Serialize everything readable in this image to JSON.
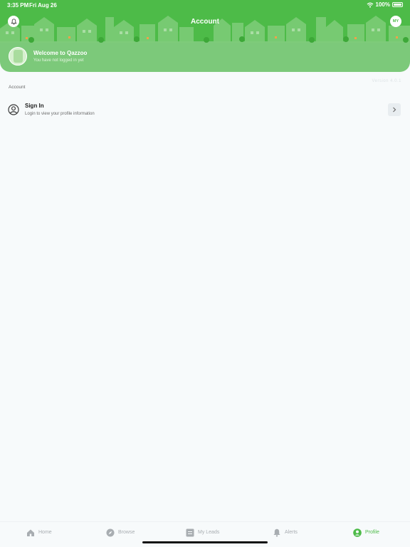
{
  "status_bar": {
    "time": "3:35 PM",
    "date": "Fri Aug 26",
    "battery": "100%"
  },
  "header": {
    "title": "Account",
    "language_badge": "MY"
  },
  "welcome": {
    "title": "Welcome to Qazzoo",
    "subtitle": "You have not logged in yet"
  },
  "version": "Version 4.0.1",
  "section": {
    "label": "Account"
  },
  "signin": {
    "title": "Sign In",
    "subtitle": "Login to view your profile information"
  },
  "tabs": [
    {
      "label": "Home",
      "icon": "home-icon",
      "active": false
    },
    {
      "label": "Browse",
      "icon": "compass-icon",
      "active": false
    },
    {
      "label": "My Leads",
      "icon": "list-icon",
      "active": false
    },
    {
      "label": "Alerts",
      "icon": "bell-icon",
      "active": false
    },
    {
      "label": "Profile",
      "icon": "person-icon",
      "active": true
    }
  ],
  "colors": {
    "brand_green": "#4dbb48",
    "header_light": "#7cc97a",
    "background": "#f7fafb",
    "inactive_tab": "#a8adb1"
  }
}
